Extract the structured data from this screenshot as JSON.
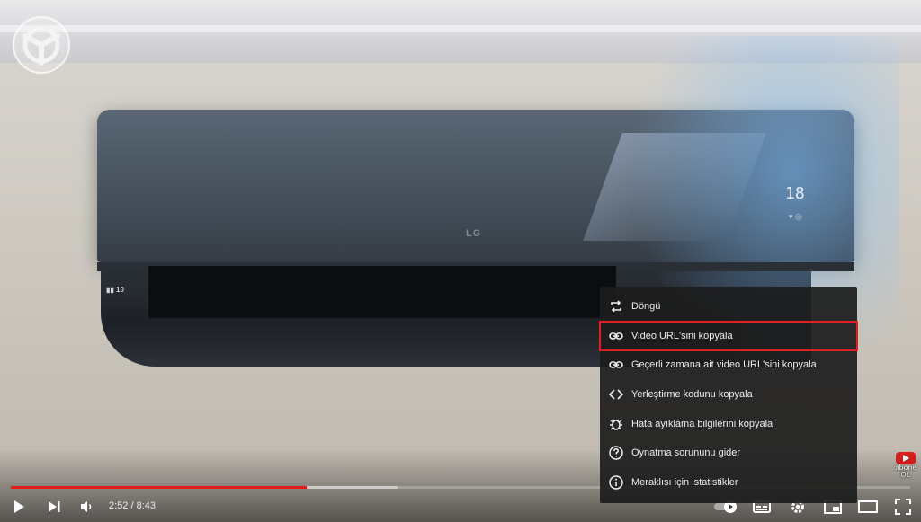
{
  "player": {
    "time_current": "2:52",
    "time_separator": " / ",
    "time_total": "8:43",
    "progress_played_fraction": 0.329,
    "progress_buffered_fraction": 0.43
  },
  "video_frame": {
    "display_reading": "18",
    "brand_logo": "LG"
  },
  "context_menu": {
    "items": [
      {
        "icon": "loop-icon",
        "label": "Döngü",
        "highlighted": false
      },
      {
        "icon": "link-icon",
        "label": "Video URL'sini kopyala",
        "highlighted": true
      },
      {
        "icon": "link-icon",
        "label": "Geçerli zamana ait video URL'sini kopyala",
        "highlighted": false
      },
      {
        "icon": "embed-code-icon",
        "label": "Yerleştirme kodunu kopyala",
        "highlighted": false
      },
      {
        "icon": "bug-icon",
        "label": "Hata ayıklama bilgilerini kopyala",
        "highlighted": false
      },
      {
        "icon": "help-circle-icon",
        "label": "Oynatma sorununu gider",
        "highlighted": false
      },
      {
        "icon": "info-icon",
        "label": "Meraklısı için istatistikler",
        "highlighted": false
      }
    ]
  },
  "watermark": {
    "abone_line1": "abone",
    "abone_line2": "OL"
  },
  "colors": {
    "progress_played": "#e21b1b",
    "highlight_outline": "#e02020",
    "menu_background": "#1c1c1c"
  }
}
